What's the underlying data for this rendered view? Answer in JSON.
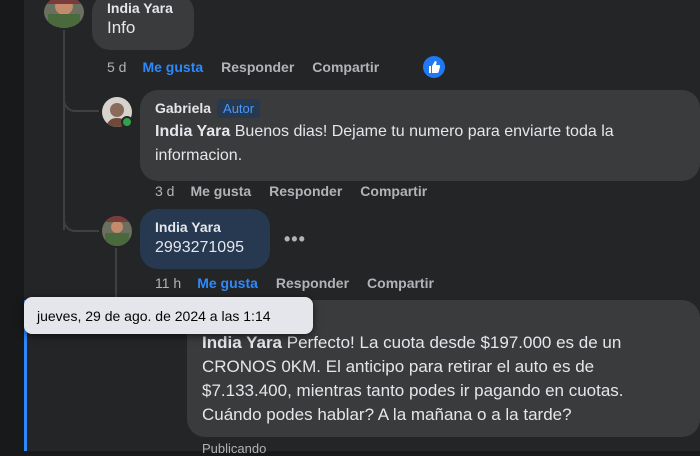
{
  "comments": [
    {
      "author": "India Yara",
      "text": "Info",
      "time": "5 d",
      "like": "Me gusta",
      "reply": "Responder",
      "share": "Compartir",
      "reaction_icon": "thumbs-up-icon"
    },
    {
      "author": "Gabriela",
      "badge": "Autor",
      "mention": "India Yara",
      "text": " Buenos dias! Dejame tu numero para enviarte toda la informacion.",
      "time": "3 d",
      "like": "Me gusta",
      "reply": "Responder",
      "share": "Compartir"
    },
    {
      "author": "India Yara",
      "text": "2993271095",
      "time": "11 h",
      "like": "Me gusta",
      "reply": "Responder",
      "share": "Compartir"
    },
    {
      "author": "Gabriela",
      "mention": "India Yara",
      "text": " Perfecto! La cuota desde $197.000 es de un CRONOS 0KM. El anticipo para retirar el auto es de $7.133.400, mientras tanto podes ir pagando en cuotas. Cuándo podes hablar? A la mañana o a la tarde?",
      "status": "Publicando"
    }
  ],
  "tooltip": "jueves, 29 de ago. de 2024 a las 1:14",
  "more_options": "•••",
  "colors": {
    "background": "#242526",
    "bubble": "#3a3b3c",
    "highlight_bubble": "#263951",
    "accent": "#2e89ff",
    "online": "#31a24c"
  }
}
